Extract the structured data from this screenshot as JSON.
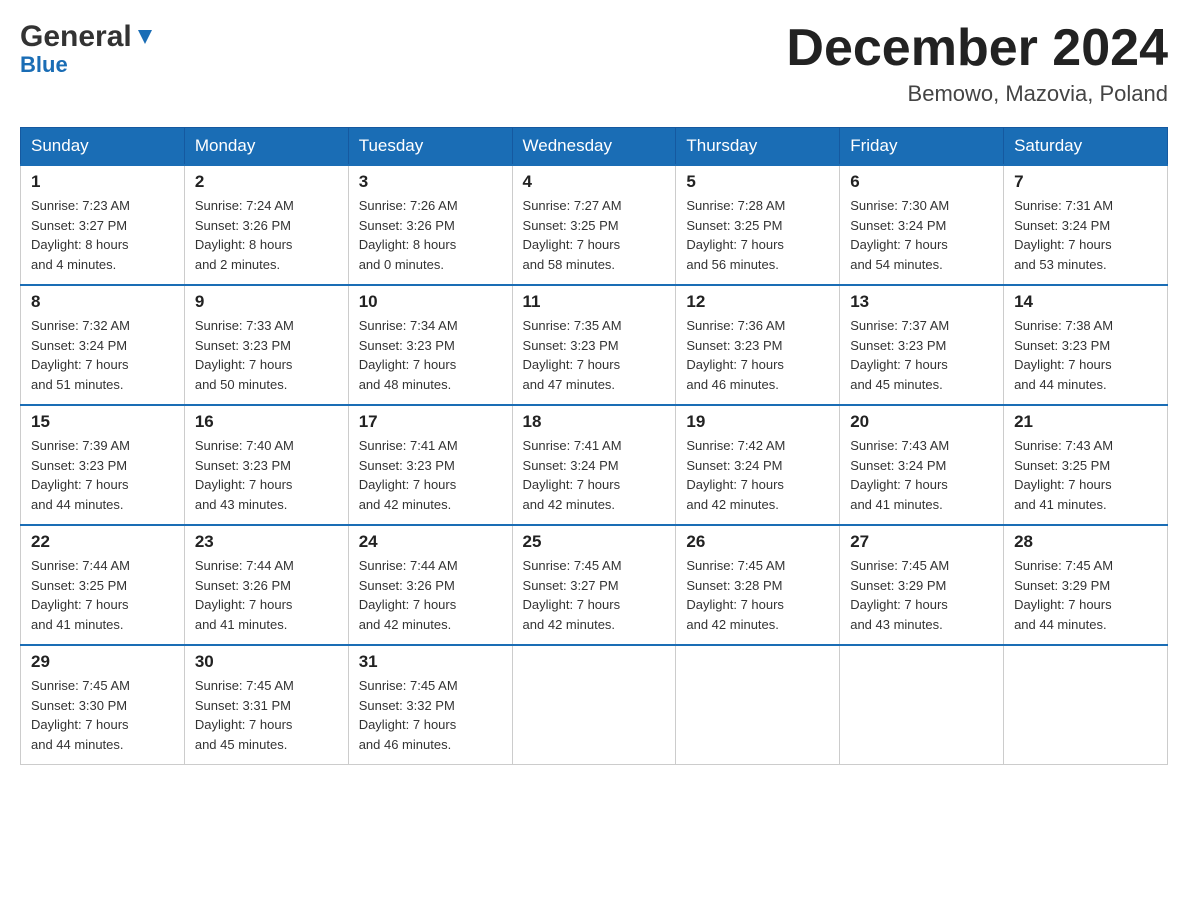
{
  "header": {
    "logo_general": "General",
    "logo_blue": "Blue",
    "month_title": "December 2024",
    "subtitle": "Bemowo, Mazovia, Poland"
  },
  "weekdays": [
    "Sunday",
    "Monday",
    "Tuesday",
    "Wednesday",
    "Thursday",
    "Friday",
    "Saturday"
  ],
  "weeks": [
    [
      {
        "day": "1",
        "sunrise": "7:23 AM",
        "sunset": "3:27 PM",
        "daylight": "8 hours and 4 minutes."
      },
      {
        "day": "2",
        "sunrise": "7:24 AM",
        "sunset": "3:26 PM",
        "daylight": "8 hours and 2 minutes."
      },
      {
        "day": "3",
        "sunrise": "7:26 AM",
        "sunset": "3:26 PM",
        "daylight": "8 hours and 0 minutes."
      },
      {
        "day": "4",
        "sunrise": "7:27 AM",
        "sunset": "3:25 PM",
        "daylight": "7 hours and 58 minutes."
      },
      {
        "day": "5",
        "sunrise": "7:28 AM",
        "sunset": "3:25 PM",
        "daylight": "7 hours and 56 minutes."
      },
      {
        "day": "6",
        "sunrise": "7:30 AM",
        "sunset": "3:24 PM",
        "daylight": "7 hours and 54 minutes."
      },
      {
        "day": "7",
        "sunrise": "7:31 AM",
        "sunset": "3:24 PM",
        "daylight": "7 hours and 53 minutes."
      }
    ],
    [
      {
        "day": "8",
        "sunrise": "7:32 AM",
        "sunset": "3:24 PM",
        "daylight": "7 hours and 51 minutes."
      },
      {
        "day": "9",
        "sunrise": "7:33 AM",
        "sunset": "3:23 PM",
        "daylight": "7 hours and 50 minutes."
      },
      {
        "day": "10",
        "sunrise": "7:34 AM",
        "sunset": "3:23 PM",
        "daylight": "7 hours and 48 minutes."
      },
      {
        "day": "11",
        "sunrise": "7:35 AM",
        "sunset": "3:23 PM",
        "daylight": "7 hours and 47 minutes."
      },
      {
        "day": "12",
        "sunrise": "7:36 AM",
        "sunset": "3:23 PM",
        "daylight": "7 hours and 46 minutes."
      },
      {
        "day": "13",
        "sunrise": "7:37 AM",
        "sunset": "3:23 PM",
        "daylight": "7 hours and 45 minutes."
      },
      {
        "day": "14",
        "sunrise": "7:38 AM",
        "sunset": "3:23 PM",
        "daylight": "7 hours and 44 minutes."
      }
    ],
    [
      {
        "day": "15",
        "sunrise": "7:39 AM",
        "sunset": "3:23 PM",
        "daylight": "7 hours and 44 minutes."
      },
      {
        "day": "16",
        "sunrise": "7:40 AM",
        "sunset": "3:23 PM",
        "daylight": "7 hours and 43 minutes."
      },
      {
        "day": "17",
        "sunrise": "7:41 AM",
        "sunset": "3:23 PM",
        "daylight": "7 hours and 42 minutes."
      },
      {
        "day": "18",
        "sunrise": "7:41 AM",
        "sunset": "3:24 PM",
        "daylight": "7 hours and 42 minutes."
      },
      {
        "day": "19",
        "sunrise": "7:42 AM",
        "sunset": "3:24 PM",
        "daylight": "7 hours and 42 minutes."
      },
      {
        "day": "20",
        "sunrise": "7:43 AM",
        "sunset": "3:24 PM",
        "daylight": "7 hours and 41 minutes."
      },
      {
        "day": "21",
        "sunrise": "7:43 AM",
        "sunset": "3:25 PM",
        "daylight": "7 hours and 41 minutes."
      }
    ],
    [
      {
        "day": "22",
        "sunrise": "7:44 AM",
        "sunset": "3:25 PM",
        "daylight": "7 hours and 41 minutes."
      },
      {
        "day": "23",
        "sunrise": "7:44 AM",
        "sunset": "3:26 PM",
        "daylight": "7 hours and 41 minutes."
      },
      {
        "day": "24",
        "sunrise": "7:44 AM",
        "sunset": "3:26 PM",
        "daylight": "7 hours and 42 minutes."
      },
      {
        "day": "25",
        "sunrise": "7:45 AM",
        "sunset": "3:27 PM",
        "daylight": "7 hours and 42 minutes."
      },
      {
        "day": "26",
        "sunrise": "7:45 AM",
        "sunset": "3:28 PM",
        "daylight": "7 hours and 42 minutes."
      },
      {
        "day": "27",
        "sunrise": "7:45 AM",
        "sunset": "3:29 PM",
        "daylight": "7 hours and 43 minutes."
      },
      {
        "day": "28",
        "sunrise": "7:45 AM",
        "sunset": "3:29 PM",
        "daylight": "7 hours and 44 minutes."
      }
    ],
    [
      {
        "day": "29",
        "sunrise": "7:45 AM",
        "sunset": "3:30 PM",
        "daylight": "7 hours and 44 minutes."
      },
      {
        "day": "30",
        "sunrise": "7:45 AM",
        "sunset": "3:31 PM",
        "daylight": "7 hours and 45 minutes."
      },
      {
        "day": "31",
        "sunrise": "7:45 AM",
        "sunset": "3:32 PM",
        "daylight": "7 hours and 46 minutes."
      },
      null,
      null,
      null,
      null
    ]
  ],
  "labels": {
    "sunrise": "Sunrise:",
    "sunset": "Sunset:",
    "daylight": "Daylight:"
  }
}
